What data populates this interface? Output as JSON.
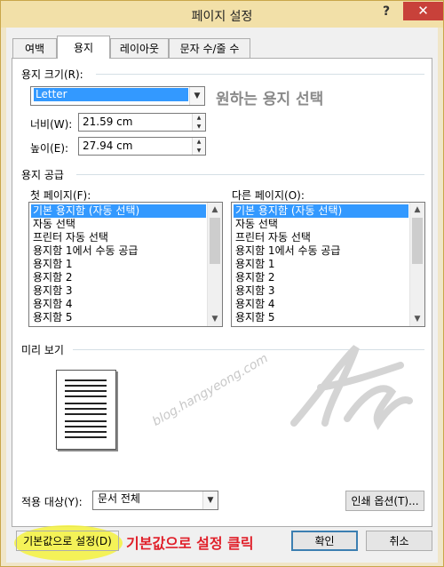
{
  "window": {
    "title": "페이지 설정",
    "help_label": "?",
    "close_label": "✕"
  },
  "tabs": [
    {
      "label": "여백"
    },
    {
      "label": "용지",
      "active": true
    },
    {
      "label": "레이아웃"
    },
    {
      "label": "문자 수/줄 수"
    }
  ],
  "paper_size": {
    "label": "용지 크기(R):",
    "selected": "Letter",
    "annotation": "원하는 용지 선택",
    "width_label": "너비(W):",
    "width_value": "21.59 cm",
    "height_label": "높이(E):",
    "height_value": "27.94 cm"
  },
  "paper_source": {
    "label": "용지 공급",
    "first_page": {
      "label": "첫 페이지(F):",
      "items": [
        "기본 용지함 (자동 선택)",
        "자동 선택",
        "프린터 자동 선택",
        "용지함 1에서 수동 공급",
        "용지함 1",
        "용지함 2",
        "용지함 3",
        "용지함 4",
        "용지함 5"
      ],
      "selected_index": 0
    },
    "other_pages": {
      "label": "다른 페이지(O):",
      "items": [
        "기본 용지함 (자동 선택)",
        "자동 선택",
        "프린터 자동 선택",
        "용지함 1에서 수동 공급",
        "용지함 1",
        "용지함 2",
        "용지함 3",
        "용지함 4",
        "용지함 5"
      ],
      "selected_index": 0
    }
  },
  "preview": {
    "label": "미리 보기",
    "watermark": "blog.hangyeong.com"
  },
  "apply_to": {
    "label": "적용 대상(Y):",
    "value": "문서 전체"
  },
  "buttons": {
    "print_options": "인쇄 옵션(T)...",
    "set_default": "기본값으로 설정(D)",
    "ok": "확인",
    "cancel": "취소"
  },
  "annotations": {
    "set_default_hint": "기본값으로 설정 클릭"
  },
  "colors": {
    "selection": "#3399ff",
    "annotation_red": "#e0202a",
    "highlight": "#f5f23d",
    "close_red": "#c8413a"
  }
}
